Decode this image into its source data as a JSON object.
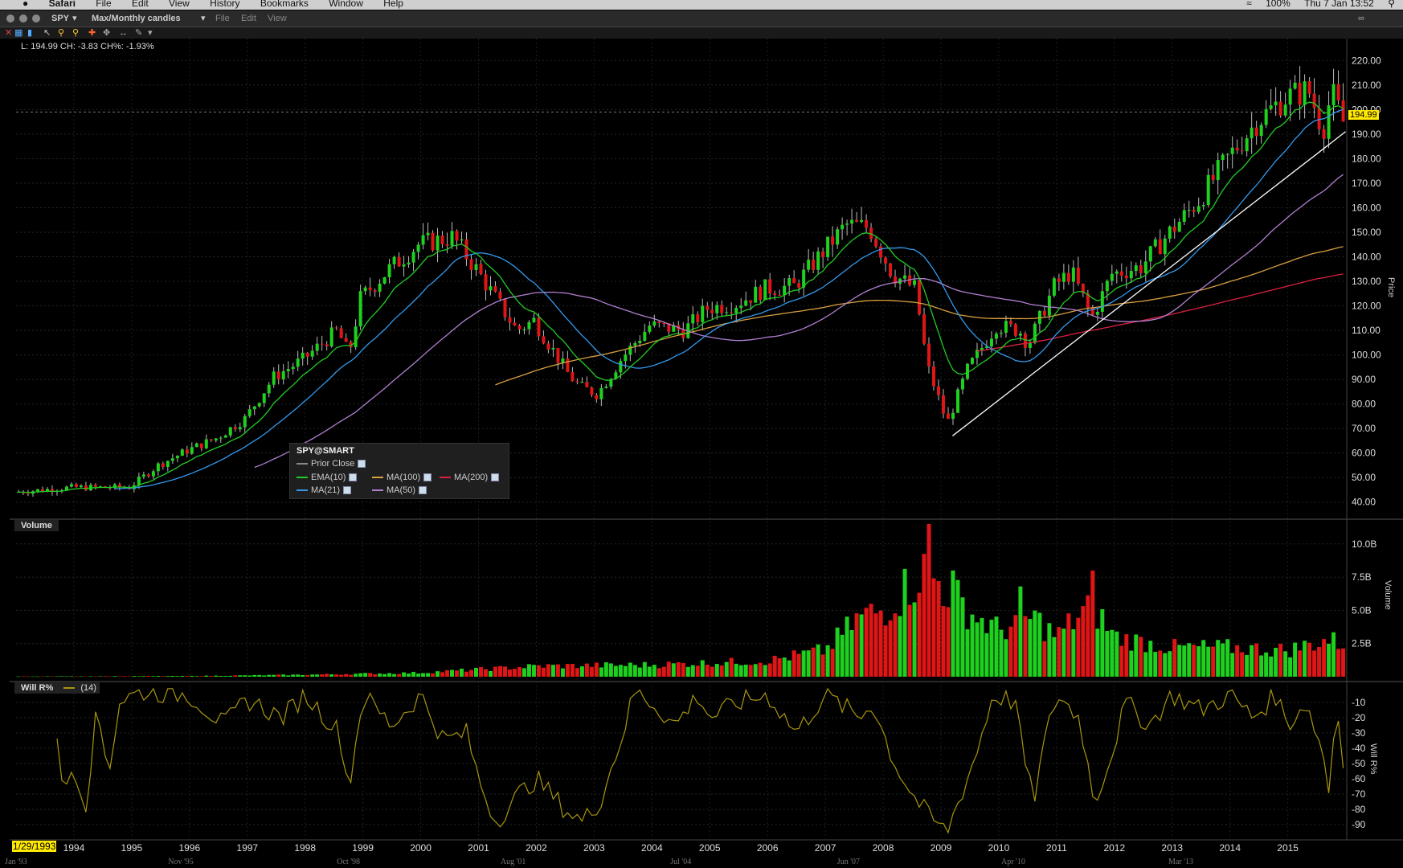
{
  "menubar": {
    "app": "Safari",
    "items": [
      "File",
      "Edit",
      "View",
      "History",
      "Bookmarks",
      "Window",
      "Help"
    ],
    "status_battery": "100%",
    "status_clock": "Thu 7 Jan  13:52"
  },
  "toolbar": {
    "symbol": "SPY",
    "interval": "Max/Monthly candles",
    "menus": [
      "File",
      "Edit",
      "View"
    ]
  },
  "readout": "L: 194.99 CH: -3.83 CH%: -1.93%",
  "last_price_label": "194.99",
  "start_date_label": "1/29/1993",
  "price_axis_title": "Price",
  "volume_axis_title": "Volume",
  "willr_axis_title": "Will R%",
  "volume_pane_label": "Volume",
  "willr_pane_label": "Will R%",
  "willr_param": "(14)",
  "legend": {
    "title": "SPY@SMART",
    "prior_close": "Prior Close",
    "ema10": "EMA(10)",
    "ma100": "MA(100)",
    "ma200": "MA(200)",
    "ma21": "MA(21)",
    "ma50": "MA(50)"
  },
  "colors": {
    "up": "#1fd11f",
    "down": "#e01515",
    "ema10": "#22cc22",
    "ma21": "#3399ee",
    "ma50": "#b080d0",
    "ma100": "#d9a040",
    "ma200": "#dd2040",
    "willr": "#a8960e",
    "trendline": "#ffffff"
  },
  "chart_data": {
    "type": "candlestick",
    "price_ticks": [
      40,
      50,
      60,
      70,
      80,
      90,
      100,
      110,
      120,
      130,
      140,
      150,
      160,
      170,
      180,
      190,
      200,
      210,
      220
    ],
    "price_ylim": [
      35,
      225
    ],
    "volume_ticks": [
      [
        "2.5B",
        2.5
      ],
      [
        "5.0B",
        5
      ],
      [
        "7.5B",
        7.5
      ],
      [
        "10.0B",
        10
      ]
    ],
    "volume_ylim": [
      0,
      11.5
    ],
    "willr_ticks": [
      -10,
      -20,
      -30,
      -40,
      -50,
      -60,
      -70,
      -80,
      -90
    ],
    "willr_ylim": [
      -100,
      0
    ],
    "years": [
      "1994",
      "1995",
      "1996",
      "1997",
      "1998",
      "1999",
      "2000",
      "2001",
      "2002",
      "2003",
      "2004",
      "2005",
      "2006",
      "2007",
      "2008",
      "2009",
      "2010",
      "2011",
      "2012",
      "2013",
      "2014",
      "2015"
    ],
    "minor_dates": [
      "Jan '93",
      "Nov '95",
      "Oct '98",
      "Aug '01",
      "Jul '04",
      "Jun '07",
      "Apr '10",
      "Mar '13"
    ],
    "xlim": [
      1993.0,
      2016.02
    ],
    "price_keypoints": [
      [
        1993.0,
        44
      ],
      [
        1994.0,
        46
      ],
      [
        1995.0,
        46
      ],
      [
        1995.5,
        55
      ],
      [
        1996.0,
        61
      ],
      [
        1996.5,
        66
      ],
      [
        1997.0,
        74
      ],
      [
        1997.5,
        91
      ],
      [
        1998.0,
        98
      ],
      [
        1998.6,
        110
      ],
      [
        1998.8,
        100
      ],
      [
        1999.0,
        123
      ],
      [
        1999.5,
        135
      ],
      [
        2000.0,
        145
      ],
      [
        2000.6,
        148
      ],
      [
        2001.0,
        135
      ],
      [
        2001.7,
        110
      ],
      [
        2002.0,
        114
      ],
      [
        2002.6,
        92
      ],
      [
        2002.8,
        87
      ],
      [
        2003.1,
        84
      ],
      [
        2003.5,
        98
      ],
      [
        2004.0,
        112
      ],
      [
        2004.6,
        110
      ],
      [
        2005.0,
        119
      ],
      [
        2005.5,
        121
      ],
      [
        2006.0,
        127
      ],
      [
        2006.5,
        128
      ],
      [
        2007.0,
        142
      ],
      [
        2007.4,
        153
      ],
      [
        2007.8,
        152
      ],
      [
        2008.2,
        133
      ],
      [
        2008.6,
        127
      ],
      [
        2008.8,
        96
      ],
      [
        2009.15,
        72
      ],
      [
        2009.5,
        94
      ],
      [
        2010.0,
        112
      ],
      [
        2010.4,
        110
      ],
      [
        2010.55,
        104
      ],
      [
        2011.0,
        128
      ],
      [
        2011.3,
        134
      ],
      [
        2011.65,
        115
      ],
      [
        2012.0,
        133
      ],
      [
        2012.5,
        136
      ],
      [
        2013.0,
        150
      ],
      [
        2013.5,
        163
      ],
      [
        2014.0,
        180
      ],
      [
        2014.5,
        195
      ],
      [
        2015.0,
        205
      ],
      [
        2015.4,
        208
      ],
      [
        2015.65,
        192
      ],
      [
        2015.8,
        207
      ],
      [
        2016.0,
        195
      ]
    ],
    "volume_keypoints": [
      [
        1993.0,
        0.02
      ],
      [
        1996.0,
        0.05
      ],
      [
        1998.0,
        0.15
      ],
      [
        2000.0,
        0.3
      ],
      [
        2002.0,
        0.8
      ],
      [
        2004.0,
        0.9
      ],
      [
        2006.0,
        1.2
      ],
      [
        2007.0,
        2.0
      ],
      [
        2007.6,
        4.5
      ],
      [
        2008.0,
        5.0
      ],
      [
        2008.7,
        8.0
      ],
      [
        2009.0,
        7.0
      ],
      [
        2009.6,
        4.5
      ],
      [
        2010.0,
        3.5
      ],
      [
        2010.6,
        4.5
      ],
      [
        2011.0,
        3.0
      ],
      [
        2011.6,
        5.5
      ],
      [
        2012.0,
        3.0
      ],
      [
        2013.0,
        2.2
      ],
      [
        2014.0,
        2.2
      ],
      [
        2015.0,
        2.0
      ],
      [
        2015.7,
        2.8
      ],
      [
        2016.0,
        2.4
      ]
    ],
    "volume_spikes": [
      [
        2008.8,
        11.5
      ],
      [
        2009.2,
        8.0
      ],
      [
        2010.35,
        6.8
      ],
      [
        2011.6,
        8.0
      ]
    ],
    "willr_keypoints": [
      [
        1993.7,
        -25
      ],
      [
        1993.8,
        -70
      ],
      [
        1994.0,
        -50
      ],
      [
        1994.2,
        -78
      ],
      [
        1994.4,
        -15
      ],
      [
        1994.6,
        -55
      ],
      [
        1994.8,
        -8
      ],
      [
        1995.2,
        -3
      ],
      [
        1996.0,
        -5
      ],
      [
        1996.6,
        -25
      ],
      [
        1997.0,
        -8
      ],
      [
        1997.6,
        -20
      ],
      [
        1998.0,
        -5
      ],
      [
        1998.6,
        -30
      ],
      [
        1998.75,
        -68
      ],
      [
        1999.0,
        -5
      ],
      [
        1999.5,
        -25
      ],
      [
        2000.0,
        -5
      ],
      [
        2000.4,
        -35
      ],
      [
        2000.8,
        -30
      ],
      [
        2001.0,
        -60
      ],
      [
        2001.3,
        -88
      ],
      [
        2001.7,
        -70
      ],
      [
        2002.0,
        -60
      ],
      [
        2002.5,
        -80
      ],
      [
        2002.8,
        -88
      ],
      [
        2003.1,
        -75
      ],
      [
        2003.5,
        -30
      ],
      [
        2003.7,
        -3
      ],
      [
        2004.0,
        -10
      ],
      [
        2004.4,
        -25
      ],
      [
        2004.8,
        -5
      ],
      [
        2005.0,
        -20
      ],
      [
        2005.5,
        -10
      ],
      [
        2006.0,
        -5
      ],
      [
        2006.5,
        -30
      ],
      [
        2007.0,
        -5
      ],
      [
        2007.6,
        -20
      ],
      [
        2007.8,
        -10
      ],
      [
        2008.2,
        -50
      ],
      [
        2008.5,
        -70
      ],
      [
        2008.8,
        -85
      ],
      [
        2009.1,
        -95
      ],
      [
        2009.3,
        -75
      ],
      [
        2009.6,
        -45
      ],
      [
        2009.9,
        -5
      ],
      [
        2010.3,
        -10
      ],
      [
        2010.4,
        -40
      ],
      [
        2010.6,
        -75
      ],
      [
        2010.8,
        -35
      ],
      [
        2011.0,
        -5
      ],
      [
        2011.4,
        -20
      ],
      [
        2011.65,
        -75
      ],
      [
        2011.9,
        -50
      ],
      [
        2012.2,
        -10
      ],
      [
        2012.6,
        -25
      ],
      [
        2013.0,
        -5
      ],
      [
        2013.5,
        -15
      ],
      [
        2014.0,
        -5
      ],
      [
        2014.4,
        -20
      ],
      [
        2014.8,
        -5
      ],
      [
        2015.0,
        -25
      ],
      [
        2015.3,
        -10
      ],
      [
        2015.6,
        -40
      ],
      [
        2015.7,
        -70
      ],
      [
        2015.85,
        -10
      ],
      [
        2016.0,
        -60
      ]
    ],
    "trendline": [
      [
        2009.2,
        67
      ],
      [
        2016.0,
        191
      ]
    ]
  }
}
